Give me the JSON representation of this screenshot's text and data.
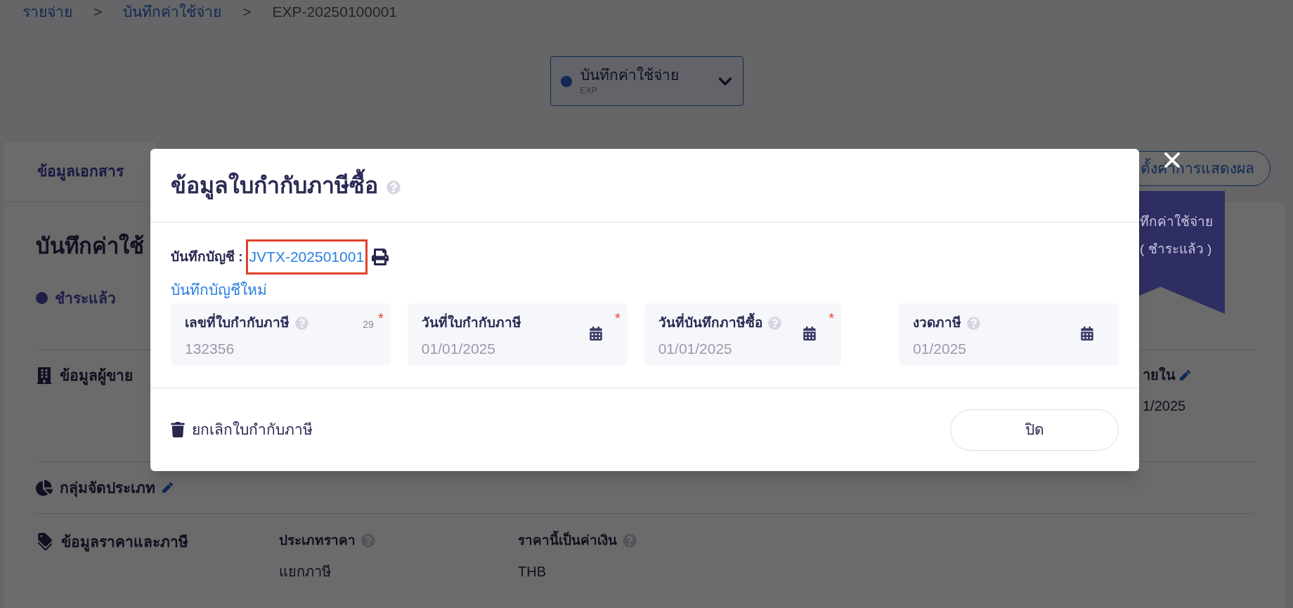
{
  "breadcrumb": [
    {
      "label": "รายจ่าย",
      "kind": "link"
    },
    {
      "label": "บันทึกค่าใช้จ่าย",
      "kind": "link"
    },
    {
      "label": "EXP-20250100001",
      "kind": "current"
    }
  ],
  "separator": ">",
  "doc_type": {
    "label": "บันทึกค่าใช้จ่าย",
    "code": "EXP"
  },
  "tabs": [
    {
      "label": "ข้อมูลเอกสาร",
      "selected": true
    }
  ],
  "settings_button": {
    "label": "ตั้งค่าการแสดงผล"
  },
  "ribbon": {
    "lines": [
      "ทึกค่าใช้จ่าย",
      "( ชำระแล้ว )"
    ]
  },
  "document": {
    "title": "บันทึกค่าใช้",
    "status": "ชำระแล้ว"
  },
  "vendor": {
    "title": "ข้อมูลผู้ขาย",
    "side_label": "ายใน",
    "side_value": "1/2025"
  },
  "classification": {
    "title": "กลุ่มจัดประเภท"
  },
  "pricing": {
    "title": "ข้อมูลราคาและภาษี",
    "fields": [
      {
        "label": "ประเภทราคา",
        "value": "แยกภาษี"
      },
      {
        "label": "ราคานี้เป็นค่าเงิน",
        "value": "THB"
      }
    ]
  },
  "modal": {
    "title": "ข้อมูลใบกำกับภาษีซื้อ",
    "journal_label": "บันทึกบัญชี :",
    "journal_link": "JVTX-202501001",
    "new_journal_link": "บันทึกบัญชีใหม่",
    "fields": [
      {
        "label": "เลขที่ใบกำกับภาษี",
        "value": "132356",
        "kind": "text",
        "help": true,
        "required": true,
        "counter": "29"
      },
      {
        "label": "วันที่ใบกำกับภาษี",
        "value": "01/01/2025",
        "kind": "date",
        "help": false,
        "required": true
      },
      {
        "label": "วันที่บันทึกภาษีซื้อ",
        "value": "01/01/2025",
        "kind": "date",
        "help": true,
        "required": true
      },
      {
        "label": "งวดภาษี",
        "value": "01/2025",
        "kind": "date",
        "help": true,
        "required": false
      }
    ],
    "required_mark": "*",
    "cancel_label": "ยกเลิกใบกำกับภาษี",
    "close_label": "ปิด"
  }
}
